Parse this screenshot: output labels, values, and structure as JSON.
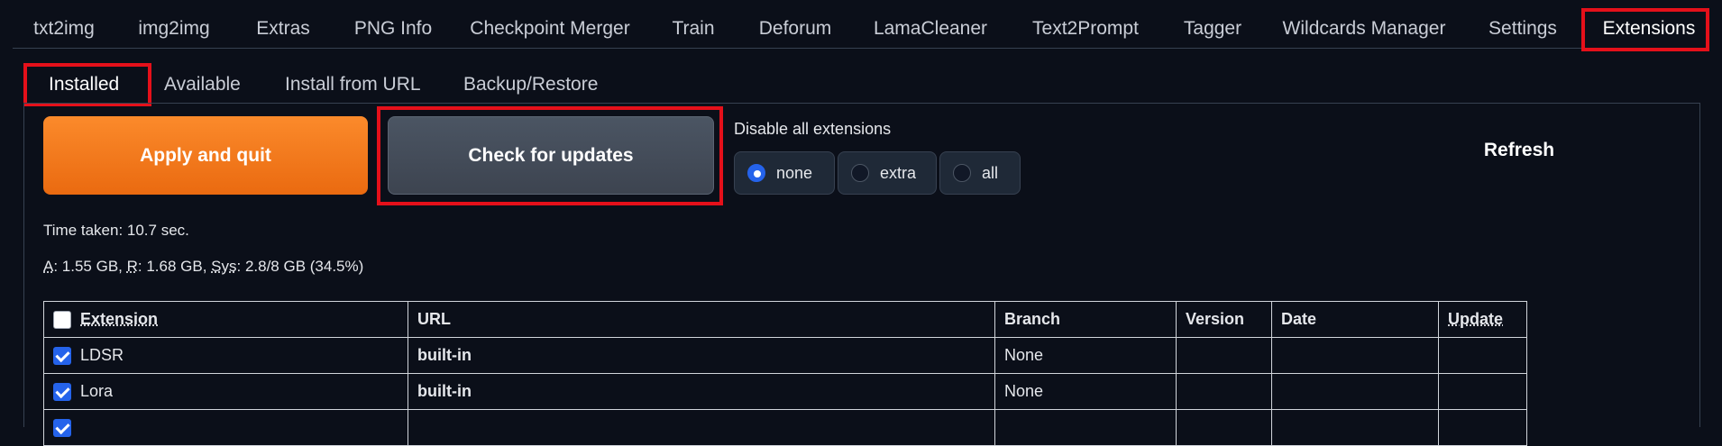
{
  "top_tabs": [
    "txt2img",
    "img2img",
    "Extras",
    "PNG Info",
    "Checkpoint Merger",
    "Train",
    "Deforum",
    "LamaCleaner",
    "Text2Prompt",
    "Tagger",
    "Wildcards Manager",
    "Settings",
    "Extensions"
  ],
  "sub_tabs": [
    "Installed",
    "Available",
    "Install from URL",
    "Backup/Restore"
  ],
  "actions": {
    "apply_label": "Apply and quit",
    "check_label": "Check for updates",
    "refresh_label": "Refresh"
  },
  "disable": {
    "label": "Disable all extensions",
    "options": [
      "none",
      "extra",
      "all"
    ],
    "selected": "none"
  },
  "status": {
    "time_taken": "Time taken: 10.7 sec.",
    "mem_a_label": "A",
    "mem_a": ": 1.55 GB, ",
    "mem_r_label": "R",
    "mem_r": ": 1.68 GB, ",
    "mem_sys_label": "Sys",
    "mem_sys": ": 2.8/8 GB (34.5%)"
  },
  "table": {
    "headers": [
      "Extension",
      "URL",
      "Branch",
      "Version",
      "Date",
      "Update"
    ],
    "rows": [
      {
        "name": "LDSR",
        "url": "built-in",
        "branch": "None",
        "version": "",
        "date": "",
        "update": "",
        "checked": true
      },
      {
        "name": "Lora",
        "url": "built-in",
        "branch": "None",
        "version": "",
        "date": "",
        "update": "",
        "checked": true
      }
    ]
  },
  "colors": {
    "accent": "#ea6a10",
    "highlight": "#e5101a",
    "checkbox": "#2563eb"
  }
}
